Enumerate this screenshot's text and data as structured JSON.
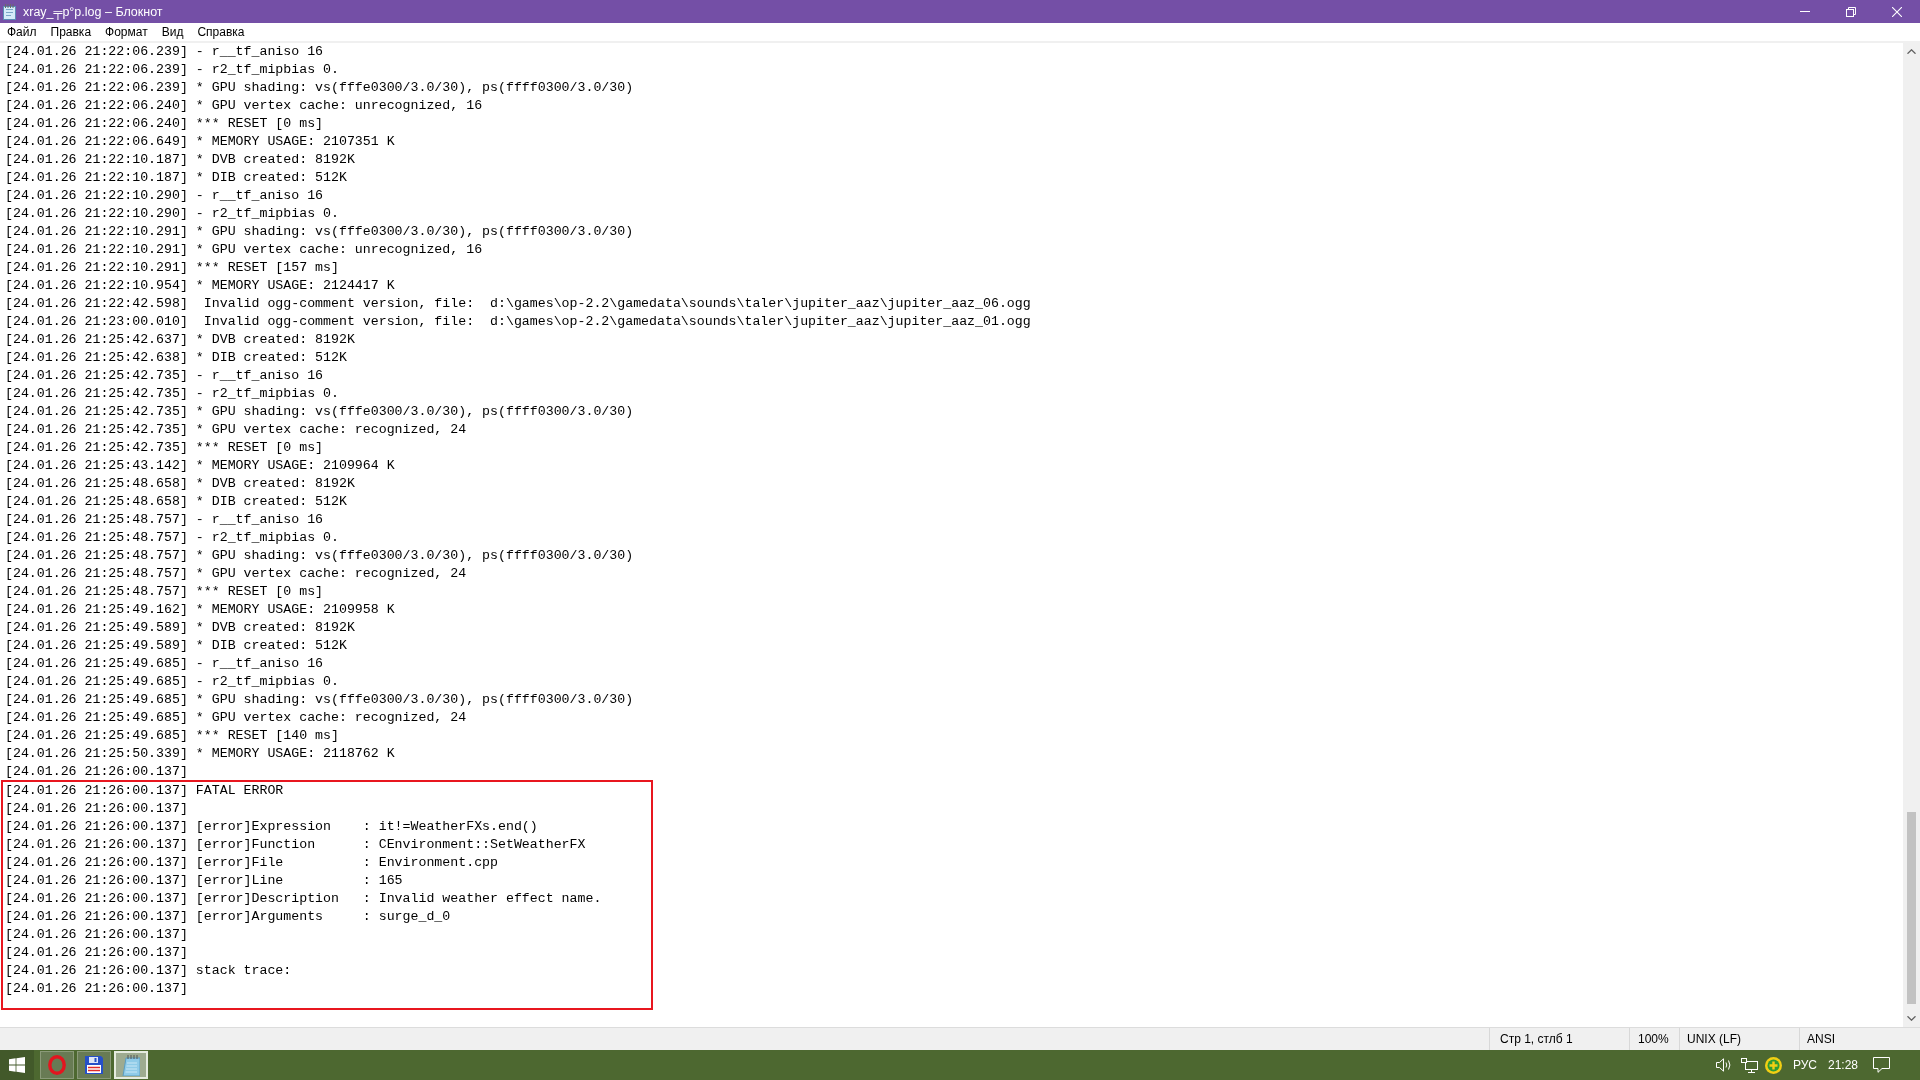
{
  "window": {
    "title": "xray_╤p°p.log – Блокнот"
  },
  "menu": [
    "Файл",
    "Правка",
    "Формат",
    "Вид",
    "Справка"
  ],
  "editor": {
    "blocks": [
      {
        "kind": "plain",
        "lines": [
          "[24.01.26 21:22:06.239] - r__tf_aniso 16",
          "[24.01.26 21:22:06.239] - r2_tf_mipbias 0.",
          "[24.01.26 21:22:06.239] * GPU shading: vs(fffe0300/3.0/30), ps(ffff0300/3.0/30)",
          "[24.01.26 21:22:06.240] * GPU vertex cache: unrecognized, 16",
          "[24.01.26 21:22:06.240] *** RESET [0 ms]",
          "[24.01.26 21:22:06.649] * MEMORY USAGE: 2107351 K",
          "[24.01.26 21:22:10.187] * DVB created: 8192K",
          "[24.01.26 21:22:10.187] * DIB created: 512K",
          "[24.01.26 21:22:10.290] - r__tf_aniso 16",
          "[24.01.26 21:22:10.290] - r2_tf_mipbias 0.",
          "[24.01.26 21:22:10.291] * GPU shading: vs(fffe0300/3.0/30), ps(ffff0300/3.0/30)",
          "[24.01.26 21:22:10.291] * GPU vertex cache: unrecognized, 16",
          "[24.01.26 21:22:10.291] *** RESET [157 ms]",
          "[24.01.26 21:22:10.954] * MEMORY USAGE: 2124417 K",
          "[24.01.26 21:22:42.598]  Invalid ogg-comment version, file:  d:\\games\\op-2.2\\gamedata\\sounds\\taler\\jupiter_aaz\\jupiter_aaz_06.ogg",
          "[24.01.26 21:23:00.010]  Invalid ogg-comment version, file:  d:\\games\\op-2.2\\gamedata\\sounds\\taler\\jupiter_aaz\\jupiter_aaz_01.ogg",
          "[24.01.26 21:25:42.637] * DVB created: 8192K",
          "[24.01.26 21:25:42.638] * DIB created: 512K",
          "[24.01.26 21:25:42.735] - r__tf_aniso 16",
          "[24.01.26 21:25:42.735] - r2_tf_mipbias 0.",
          "[24.01.26 21:25:42.735] * GPU shading: vs(fffe0300/3.0/30), ps(ffff0300/3.0/30)",
          "[24.01.26 21:25:42.735] * GPU vertex cache: recognized, 24",
          "[24.01.26 21:25:42.735] *** RESET [0 ms]",
          "[24.01.26 21:25:43.142] * MEMORY USAGE: 2109964 K",
          "[24.01.26 21:25:48.658] * DVB created: 8192K",
          "[24.01.26 21:25:48.658] * DIB created: 512K",
          "[24.01.26 21:25:48.757] - r__tf_aniso 16",
          "[24.01.26 21:25:48.757] - r2_tf_mipbias 0.",
          "[24.01.26 21:25:48.757] * GPU shading: vs(fffe0300/3.0/30), ps(ffff0300/3.0/30)",
          "[24.01.26 21:25:48.757] * GPU vertex cache: recognized, 24",
          "[24.01.26 21:25:48.757] *** RESET [0 ms]",
          "[24.01.26 21:25:49.162] * MEMORY USAGE: 2109958 K",
          "[24.01.26 21:25:49.589] * DVB created: 8192K",
          "[24.01.26 21:25:49.589] * DIB created: 512K",
          "[24.01.26 21:25:49.685] - r__tf_aniso 16",
          "[24.01.26 21:25:49.685] - r2_tf_mipbias 0.",
          "[24.01.26 21:25:49.685] * GPU shading: vs(fffe0300/3.0/30), ps(ffff0300/3.0/30)",
          "[24.01.26 21:25:49.685] * GPU vertex cache: recognized, 24",
          "[24.01.26 21:25:49.685] *** RESET [140 ms]",
          "[24.01.26 21:25:50.339] * MEMORY USAGE: 2118762 K",
          "[24.01.26 21:26:00.137]"
        ]
      },
      {
        "kind": "highlighted",
        "lines": [
          "[24.01.26 21:26:00.137] FATAL ERROR",
          "[24.01.26 21:26:00.137]",
          "[24.01.26 21:26:00.137] [error]Expression    : it!=WeatherFXs.end()",
          "[24.01.26 21:26:00.137] [error]Function      : CEnvironment::SetWeatherFX",
          "[24.01.26 21:26:00.137] [error]File          : Environment.cpp",
          "[24.01.26 21:26:00.137] [error]Line          : 165",
          "[24.01.26 21:26:00.137] [error]Description   : Invalid weather effect name.",
          "[24.01.26 21:26:00.137] [error]Arguments     : surge_d_0",
          "[24.01.26 21:26:00.137]",
          "[24.01.26 21:26:00.137]",
          "[24.01.26 21:26:00.137] stack trace:",
          "[24.01.26 21:26:00.137]"
        ]
      }
    ]
  },
  "status_bar": {
    "position": "Стр 1, стлб 1",
    "zoom": "100%",
    "line_ending": "UNIX (LF)",
    "encoding": "ANSI"
  },
  "taskbar": {
    "apps": [
      {
        "kind": "browser",
        "selected": false
      },
      {
        "kind": "floppy",
        "selected": false
      },
      {
        "kind": "notepad",
        "selected": true
      }
    ],
    "language": "РУС",
    "time": "21:28"
  }
}
